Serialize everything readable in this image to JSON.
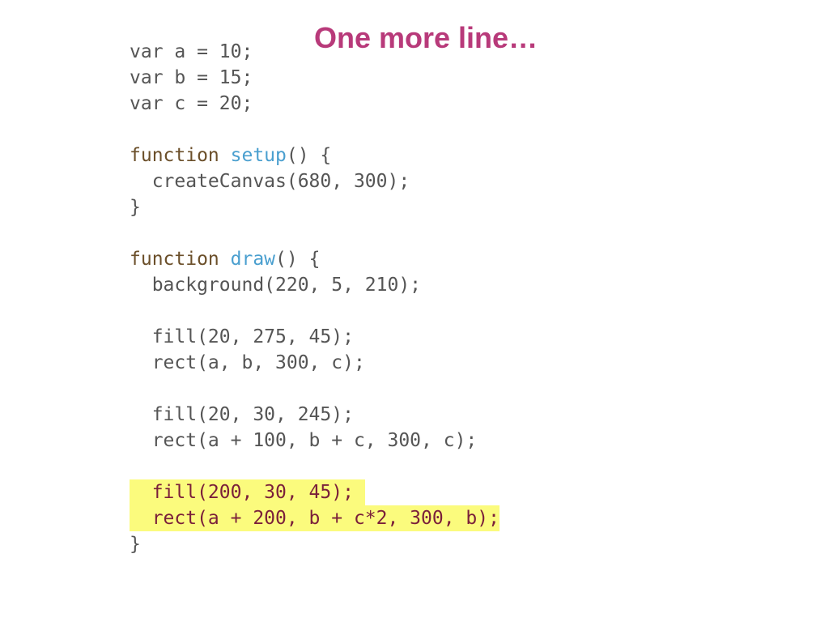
{
  "slide": {
    "title": "One more line…"
  },
  "code": {
    "lines": [
      {
        "text": "var a = 10;"
      },
      {
        "text": "var b = 15;"
      },
      {
        "text": "var c = 20;"
      },
      {
        "text": ""
      },
      {
        "keyword": "function",
        "space": " ",
        "name": "setup",
        "rest": "() {"
      },
      {
        "text": "  createCanvas(680, 300);"
      },
      {
        "text": "}"
      },
      {
        "text": ""
      },
      {
        "keyword": "function",
        "space": " ",
        "name": "draw",
        "rest": "() {"
      },
      {
        "text": "  background(220, 5, 210);"
      },
      {
        "text": ""
      },
      {
        "text": "  fill(20, 275, 45);"
      },
      {
        "text": "  rect(a, b, 300, c);"
      },
      {
        "text": ""
      },
      {
        "text": "  fill(20, 30, 245);"
      },
      {
        "text": "  rect(a + 100, b + c, 300, c);"
      },
      {
        "text": ""
      },
      {
        "text": "  fill(200, 30, 45); "
      },
      {
        "text": "  rect(a + 200, b + c*2, 300, b);"
      },
      {
        "text": "}"
      }
    ]
  },
  "colors": {
    "title": "#b83a7a",
    "code_text": "#555555",
    "keyword": "#6b4f2a",
    "function_name": "#4a9fcf",
    "highlight_background": "#fbfb7d",
    "highlight_text": "#7a1f3a"
  }
}
